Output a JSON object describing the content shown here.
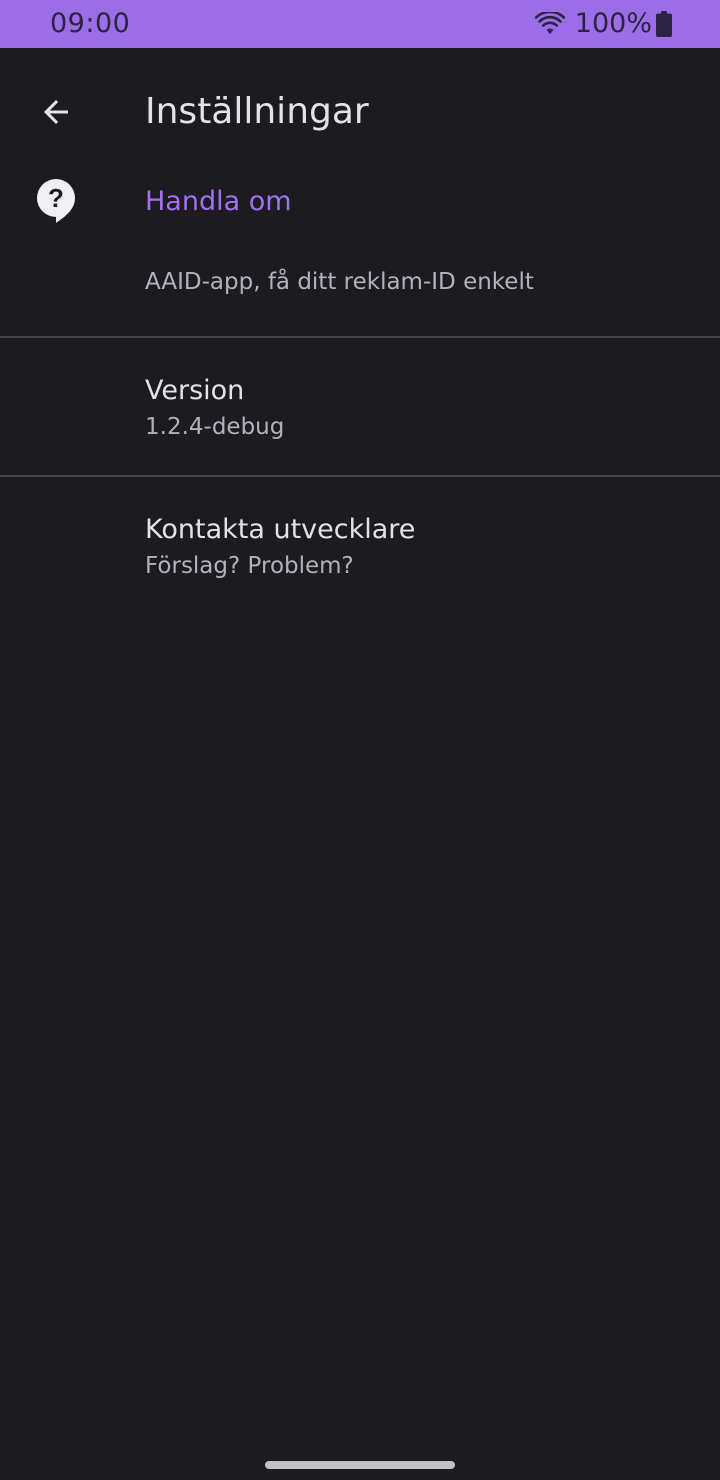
{
  "status_bar": {
    "time": "09:00",
    "battery": "100%",
    "wifi_icon": "wifi-icon",
    "battery_icon": "battery-full-icon",
    "background": "#9b6de6"
  },
  "app_bar": {
    "title": "Inställningar",
    "back_icon": "arrow-back-icon"
  },
  "about_category": {
    "icon": "help-circle-icon",
    "title": "Handla om",
    "summary": "AAID-app, få ditt reklam-ID enkelt",
    "accent_color": "#a370f0"
  },
  "preferences": [
    {
      "title": "Version",
      "summary": "1.2.4-debug"
    },
    {
      "title": "Kontakta utvecklare",
      "summary": "Förslag? Problem?"
    }
  ],
  "colors": {
    "background": "#1c1b20",
    "divider": "#48454e",
    "text_primary": "#e6e1e5",
    "text_secondary": "#b5b0bd"
  }
}
